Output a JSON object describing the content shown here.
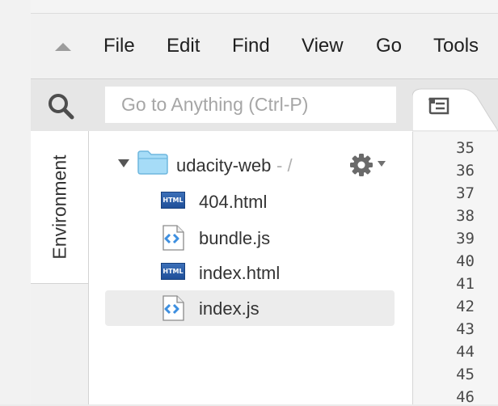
{
  "menubar": {
    "collapse_icon": "triangle-up-icon",
    "items": [
      {
        "label": "File"
      },
      {
        "label": "Edit"
      },
      {
        "label": "Find"
      },
      {
        "label": "View"
      },
      {
        "label": "Go"
      },
      {
        "label": "Tools"
      }
    ]
  },
  "search": {
    "icon": "search-icon",
    "placeholder": "Go to Anything (Ctrl-P)"
  },
  "sidebar": {
    "environment_tab_label": "Environment"
  },
  "tree": {
    "root": {
      "name": "udacity-web",
      "path_suffix": "- /",
      "expanded": true,
      "icon": "folder-icon",
      "settings_icon": "gear-icon"
    },
    "files": [
      {
        "name": "404.html",
        "type": "html",
        "icon": "html-file-icon",
        "selected": false
      },
      {
        "name": "bundle.js",
        "type": "js",
        "icon": "js-file-icon",
        "selected": false
      },
      {
        "name": "index.html",
        "type": "html",
        "icon": "html-file-icon",
        "selected": false
      },
      {
        "name": "index.js",
        "type": "js",
        "icon": "js-file-icon",
        "selected": true
      }
    ],
    "html_badge_text": "HTML"
  },
  "editor": {
    "tab_icon": "editor-tab-icon",
    "line_numbers": [
      "35",
      "36",
      "37",
      "38",
      "39",
      "40",
      "41",
      "42",
      "43",
      "44",
      "45",
      "46"
    ]
  },
  "colors": {
    "folder": "#a6dcf7",
    "js_icon": "#3d8fe0",
    "html_badge": "#2d5fa8",
    "selected_row": "#ececec"
  }
}
